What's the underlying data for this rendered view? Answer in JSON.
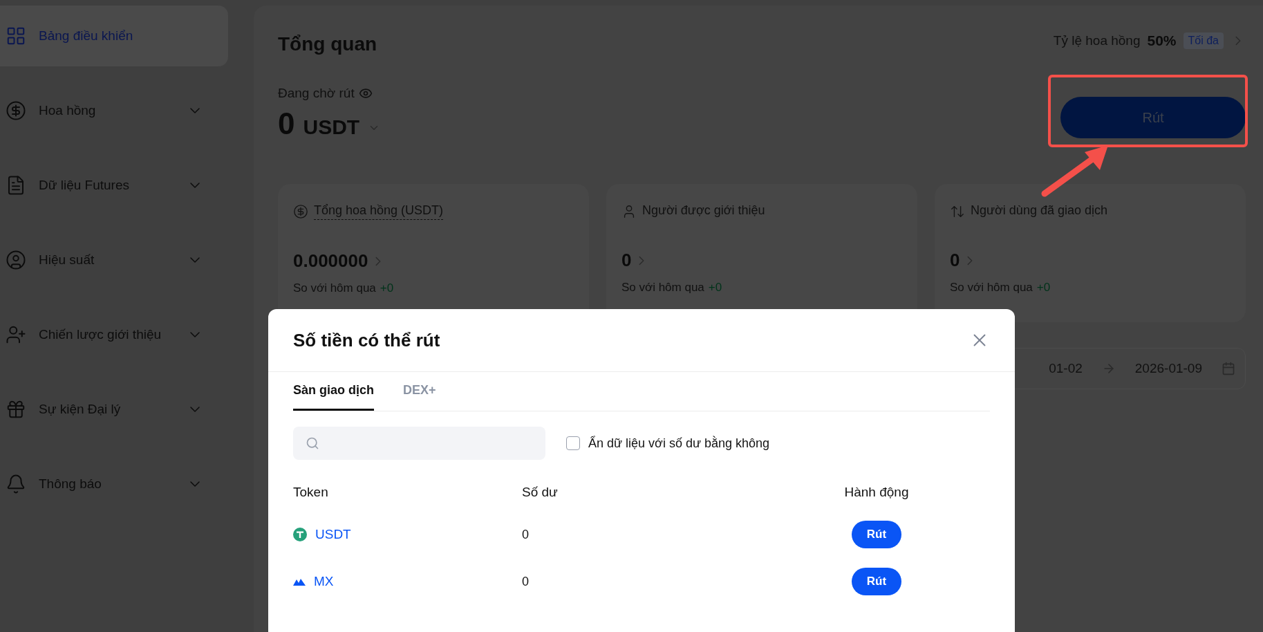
{
  "sidebar": {
    "items": [
      {
        "label": "Bảng điều khiển",
        "kind": "link",
        "selected": true
      },
      {
        "label": "Hoa hồng",
        "kind": "menu",
        "selected": false
      },
      {
        "label": "Dữ liệu Futures",
        "kind": "menu",
        "selected": false
      },
      {
        "label": "Hiệu suất",
        "kind": "menu",
        "selected": false
      },
      {
        "label": "Chiến lược giới thiệu",
        "kind": "menu",
        "selected": false
      },
      {
        "label": "Sự kiện Đại lý",
        "kind": "menu",
        "selected": false
      },
      {
        "label": "Thông báo",
        "kind": "menu",
        "selected": false
      }
    ]
  },
  "overview": {
    "title": "Tổng quan",
    "commission_rate": {
      "label": "Tỷ lệ hoa hồng",
      "value": "50%",
      "badge": "Tối đa"
    },
    "pending": {
      "label": "Đang chờ rút",
      "amount": "0",
      "currency": "USDT"
    },
    "withdraw_button": "Rút",
    "stat_cards": [
      {
        "title": "Tổng hoa hồng (USDT)",
        "dashed": true,
        "value": "0.000000",
        "compare_label": "So với hôm qua",
        "change": "+0"
      },
      {
        "title": "Người được giới thiệu",
        "dashed": false,
        "value": "0",
        "compare_label": "So với hôm qua",
        "change": "+0"
      },
      {
        "title": "Người dùng đã giao dịch",
        "dashed": false,
        "value": "0",
        "compare_label": "So với hôm qua",
        "change": "+0"
      }
    ],
    "date_range": {
      "start": "01-02",
      "end": "2026-01-09"
    }
  },
  "modal": {
    "title": "Số tiền có thể rút",
    "tabs": [
      {
        "label": "Sàn giao dịch",
        "selected": true
      },
      {
        "label": "DEX+",
        "selected": false
      }
    ],
    "hide_zero": {
      "label": "Ẩn dữ liệu với số dư bằng không",
      "checked": false
    },
    "columns": [
      "Token",
      "Số dư",
      "Hành động"
    ],
    "rows": [
      {
        "token": "USDT",
        "kind": "usdt",
        "balance": "0",
        "action": "Rút"
      },
      {
        "token": "MX",
        "kind": "mx",
        "balance": "0",
        "action": "Rút"
      }
    ]
  }
}
